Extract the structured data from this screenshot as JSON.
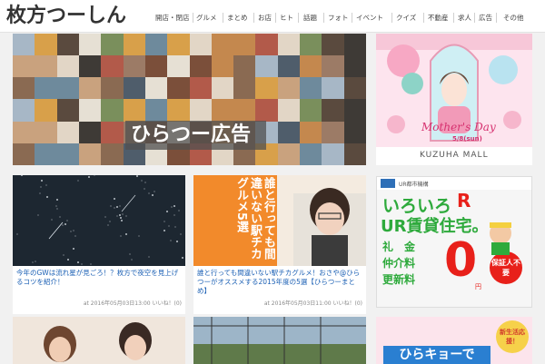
{
  "site": {
    "logo_text": "枚方つーしん"
  },
  "nav": {
    "items": [
      "開店・閉店",
      "グルメ",
      "まとめ",
      "お店",
      "ヒト",
      "話題",
      "フォト",
      "イベント",
      "クイズ",
      "不動産",
      "求人",
      "広告",
      "その他"
    ]
  },
  "banner": {
    "label": "ひらつー広告"
  },
  "ad_mothers": {
    "title": "Mother's Day",
    "date": "5/8(sun)",
    "brand": "KUZUHA MALL"
  },
  "articles": [
    {
      "caption": "今年のGWは流れ星が見ごろ！？枚方で夜空を見上げるコツを紹介！",
      "meta": "at 2016年05月03日13:00 いいね！(0)"
    },
    {
      "caption": "誰と行っても間違いない駅チカグルメ！おさや@ひらつーがオススメする2015年度の5選【ひらつーまとめ】",
      "meta": "at 2016年05月03日11:00 いいね！(0)",
      "overlay_text": "誰と行っても間違いない駅チカグルメ5選"
    }
  ],
  "ad_ur": {
    "top_label": "UR都市機構",
    "headline1": "いろいろ",
    "headline_r": "R",
    "headline2": "UR賃貸住宅。",
    "fee1": "礼　金",
    "fee2": "仲介料",
    "fee3": "更新料",
    "zero": "0",
    "yen": "円",
    "badge": "保証人不要"
  },
  "ad_hirakyo": {
    "badge": "新生活応援！",
    "title": "ひらキョーで"
  },
  "colors": {
    "link": "#1a5fb4",
    "ur_green": "#2eaa3c",
    "ur_red": "#e8201a",
    "ad_pink": "#fde4ee"
  }
}
